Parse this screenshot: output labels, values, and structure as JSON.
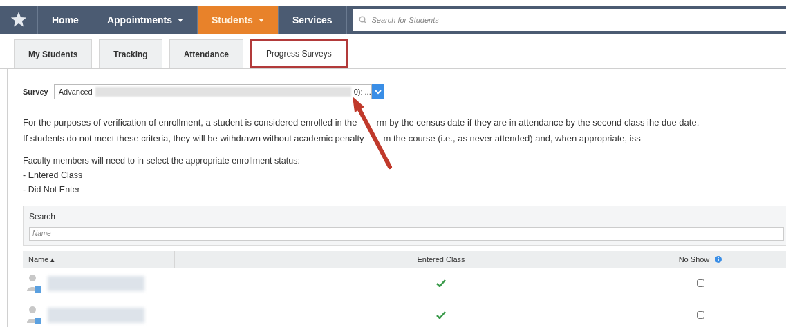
{
  "nav": {
    "items": [
      {
        "label": "Home",
        "dropdown": false,
        "selected": false
      },
      {
        "label": "Appointments",
        "dropdown": true,
        "selected": false
      },
      {
        "label": "Students",
        "dropdown": true,
        "selected": true
      },
      {
        "label": "Services",
        "dropdown": false,
        "selected": false
      }
    ],
    "search": {
      "placeholder": "Search for Students"
    }
  },
  "tabs": [
    {
      "label": "My Students",
      "selected": false
    },
    {
      "label": "Tracking",
      "selected": false
    },
    {
      "label": "Attendance",
      "selected": false
    },
    {
      "label": "Progress Surveys",
      "selected": true
    }
  ],
  "survey": {
    "label": "Survey",
    "value_start": "Advanced",
    "value_end": "0): ..."
  },
  "paragraphs": [
    {
      "before": "For the purposes of verification of enrollment, a student is considered enrolled in the",
      "after": "rm by the census date if they are in attendance by the second class ihe due date."
    },
    {
      "before": "If students do not meet these criteria, they will be withdrawn without academic penalty",
      "after": "m the course (i.e., as never attended) and, when appropriate, iss"
    }
  ],
  "instructions": {
    "intro": "Faculty members will need to in select the appropriate enrollment status:",
    "options": [
      "- Entered Class",
      "- Did Not Enter"
    ]
  },
  "filter": {
    "label": "Search",
    "placeholder": "Name"
  },
  "table": {
    "columns": [
      "Name ▴",
      "Entered Class",
      "No Show"
    ],
    "rows": [
      {
        "entered": true,
        "no_show": false
      },
      {
        "entered": true,
        "no_show": false
      }
    ]
  }
}
